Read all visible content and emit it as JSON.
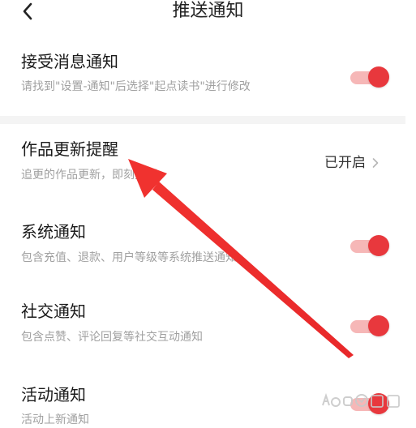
{
  "header": {
    "title": "推送通知",
    "back_icon": "chevron-left-icon"
  },
  "settings": [
    {
      "title": "接受消息通知",
      "description": "请找到\"设置-通知\"后选择\"起点读书\"进行修改",
      "control": "toggle",
      "enabled": true
    },
    {
      "title": "作品更新提醒",
      "description": "追更的作品更新，即刻提醒",
      "control": "status",
      "status_text": "已开启",
      "chevron_icon": "chevron-right-icon"
    },
    {
      "title": "系统通知",
      "description": "包含充值、退款、用户等级等系统推送通知",
      "control": "toggle",
      "enabled": true
    },
    {
      "title": "社交通知",
      "description": "包含点赞、评论回复等社交互动通知",
      "control": "toggle",
      "enabled": true
    },
    {
      "title": "活动通知",
      "description": "活动上新通知",
      "control": "toggle",
      "enabled": true
    }
  ],
  "colors": {
    "accent": "#e8383d",
    "toggle_track": "#f6b7b7",
    "annotation_arrow": "#f0322f",
    "section_gap": "#f4f4f4"
  },
  "overlay": {
    "annotation": "red-arrow-pointing-to-作品更新提醒",
    "watermark_icon": "baidu-jingyan-watermark"
  }
}
